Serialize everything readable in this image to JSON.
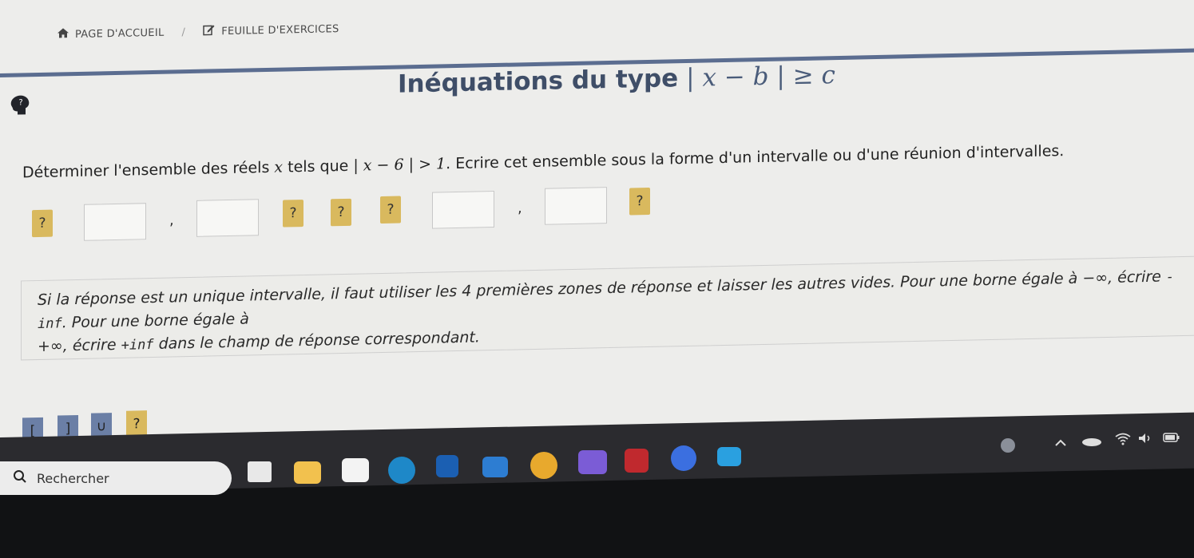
{
  "breadcrumb": {
    "home_label": "PAGE D'ACCUEIL",
    "exercises_label": "FEUILLE D'EXERCICES"
  },
  "title": {
    "text": "Inéquations du type",
    "math": "| x − b | ≥ c"
  },
  "question": {
    "prefix": "Déterminer l'ensemble des réels",
    "var": "x",
    "middle": "tels que",
    "math": "| x − 6 | > 1",
    "suffix": ". Ecrire cet ensemble sous la forme d'un intervalle ou d'une réunion d'intervalles."
  },
  "answers": {
    "q_label": "?",
    "comma": ","
  },
  "hint": {
    "part1": "Si la réponse est un unique intervalle, il faut utiliser les 4 premières zones de réponse et laisser les autres vides. Pour une borne égale à −∞, écrire ",
    "code1": "-inf",
    "part2": ". Pour une borne égale à",
    "part3": "+∞, écrire ",
    "code2": "+inf",
    "part4": " dans le champ de réponse correspondant."
  },
  "tools": {
    "open_bracket": "[",
    "close_bracket": "]",
    "union": "∪",
    "unknown": "?"
  },
  "taskbar": {
    "search_label": "Rechercher"
  },
  "colors": {
    "accent_bar": "#5b6d90",
    "answer_button": "#d9b95e",
    "tool_button": "#5b6d90"
  }
}
